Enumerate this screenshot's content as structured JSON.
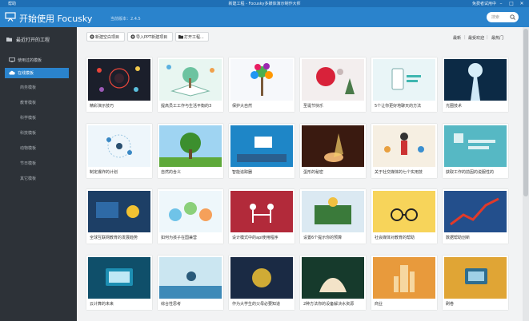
{
  "window": {
    "help": "帮助",
    "title": "新建工程 - Focusky多媒体演示制作大师",
    "free_use": "免费者试用中"
  },
  "header": {
    "title": "开始使用 Focusky",
    "version": "当前版本：2.4.5"
  },
  "search": {
    "placeholder": "搜索"
  },
  "sidebar": {
    "recent": "最近打开的工程",
    "items": [
      {
        "label": "使用过的模板"
      },
      {
        "label": "在线模板"
      }
    ],
    "subitems": [
      "商务模板",
      "教育模板",
      "科学模板",
      "科技模板",
      "动物模板",
      "节日模板",
      "其它模板"
    ]
  },
  "toolbar": {
    "new_blank": "新建空白项目",
    "import_ppt": "导入PPT新建项目",
    "open_project": "打开工程..."
  },
  "sort": {
    "latest": "最新",
    "most_recommended": "最受欢迎",
    "most_popular": "最热门",
    "separator": "|"
  },
  "colors": {
    "accent": "#2a83cc",
    "titlebar": "#1f6fb5",
    "sidebar_bg": "#2d3238"
  },
  "templates": [
    {
      "caption": "精彩演示技巧"
    },
    {
      "caption": "提高员工工作与生活平衡的3"
    },
    {
      "caption": "保护大自然"
    },
    {
      "caption": "圣诞节快乐"
    },
    {
      "caption": "5个让你更好地聊天的方法"
    },
    {
      "caption": "光圈技术"
    },
    {
      "caption": "制定爆炸的计划"
    },
    {
      "caption": "自然的含义"
    },
    {
      "caption": "智能追踪器"
    },
    {
      "caption": "蛋形的秘密"
    },
    {
      "caption": "关于社交媒体的七个实用技"
    },
    {
      "caption": "获取工作的前因的说服性的"
    },
    {
      "caption": "全球互联网教育的发展趋势"
    },
    {
      "caption": "如何为孩子在国兼营"
    },
    {
      "caption": "设计模式中的api使用程序"
    },
    {
      "caption": "设置6个提示你的预算"
    },
    {
      "caption": "社会媒体对教育的帮助"
    },
    {
      "caption": "数据帮助创新"
    },
    {
      "caption": "云计算的未来"
    },
    {
      "caption": "综合性思考"
    },
    {
      "caption": "作为大学生的父母必要知道"
    },
    {
      "caption": "2种方法你的设备解决水资源"
    },
    {
      "caption": "商业"
    },
    {
      "caption": "刷卷"
    }
  ]
}
